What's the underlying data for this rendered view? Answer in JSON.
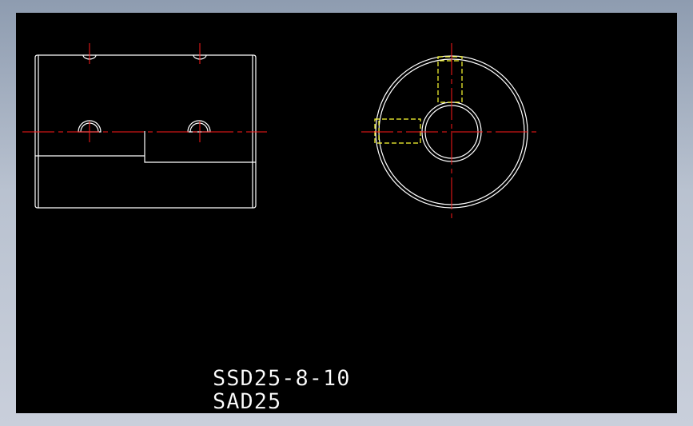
{
  "colors": {
    "background": "#000000",
    "outline": "#ffffff",
    "centerline": "#ff1a1a",
    "hidden": "#ffff33"
  },
  "labels": {
    "part_number": "SSD25-8-10",
    "model": "SAD25"
  }
}
